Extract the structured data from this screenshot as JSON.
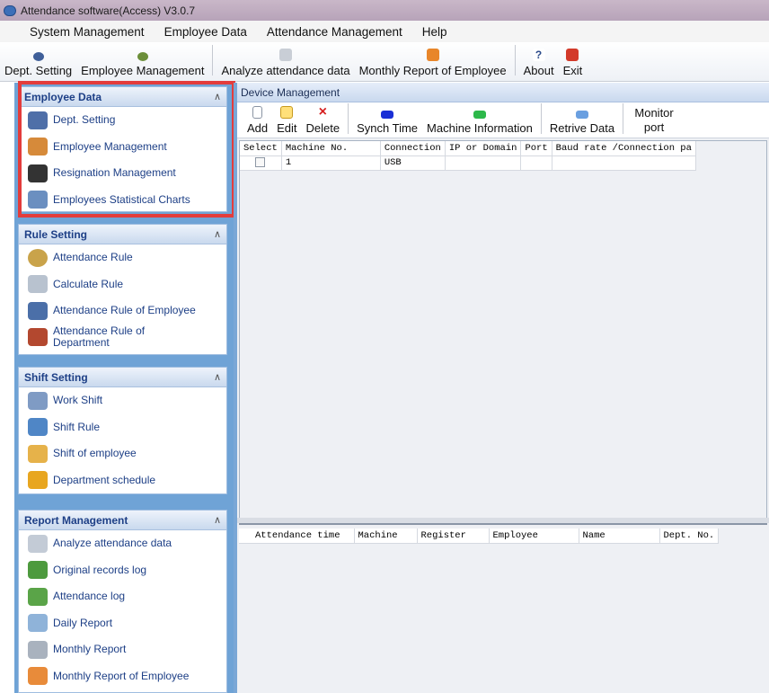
{
  "window": {
    "title": "Attendance software(Access) V3.0.7"
  },
  "menu": [
    "System Management",
    "Employee Data",
    "Attendance Management",
    "Help"
  ],
  "toolbar": [
    {
      "label": "Dept. Setting",
      "icon": "people-icon"
    },
    {
      "label": "Employee Management",
      "icon": "employee-icon"
    },
    {
      "label": "Analyze attendance data",
      "icon": "analyze-icon"
    },
    {
      "label": "Monthly Report of Employee",
      "icon": "report-icon"
    },
    {
      "label": "About",
      "icon": "help-icon"
    },
    {
      "label": "Exit",
      "icon": "exit-icon"
    }
  ],
  "sidebar": {
    "groups": [
      {
        "title": "Employee Data",
        "items": [
          "Dept. Setting",
          "Employee Management",
          "Resignation Management",
          "Employees Statistical Charts"
        ]
      },
      {
        "title": "Rule Setting",
        "items": [
          "Attendance Rule",
          "Calculate Rule",
          "Attendance Rule of Employee",
          "Attendance Rule of Department"
        ]
      },
      {
        "title": "Shift Setting",
        "items": [
          "Work Shift",
          "Shift Rule",
          "Shift of employee",
          "Department schedule"
        ]
      },
      {
        "title": "Report Management",
        "items": [
          "Analyze attendance data",
          "Original records log",
          "Attendance log",
          "Daily Report",
          "Monthly Report",
          "Monthly Report of Employee"
        ]
      }
    ]
  },
  "device": {
    "panel_title": "Device Management",
    "buttons": [
      "Add",
      "Edit",
      "Delete",
      "Synch Time",
      "Machine Information",
      "Retrive Data",
      "Monitor port"
    ],
    "columns": [
      "Select",
      "Machine No.",
      "Connection",
      "IP or Domain",
      "Port",
      "Baud rate /Connection pa"
    ],
    "rows": [
      {
        "machine_no": "1",
        "connection": "USB"
      }
    ]
  },
  "records": {
    "columns": [
      "Attendance time",
      "Machine",
      "Register",
      "Employee",
      "Name",
      "Dept. No."
    ]
  },
  "colors": {
    "accent": "#1d3f86",
    "highlight": "#e33c3c",
    "sidebar_bg": "#6fa3d6"
  }
}
